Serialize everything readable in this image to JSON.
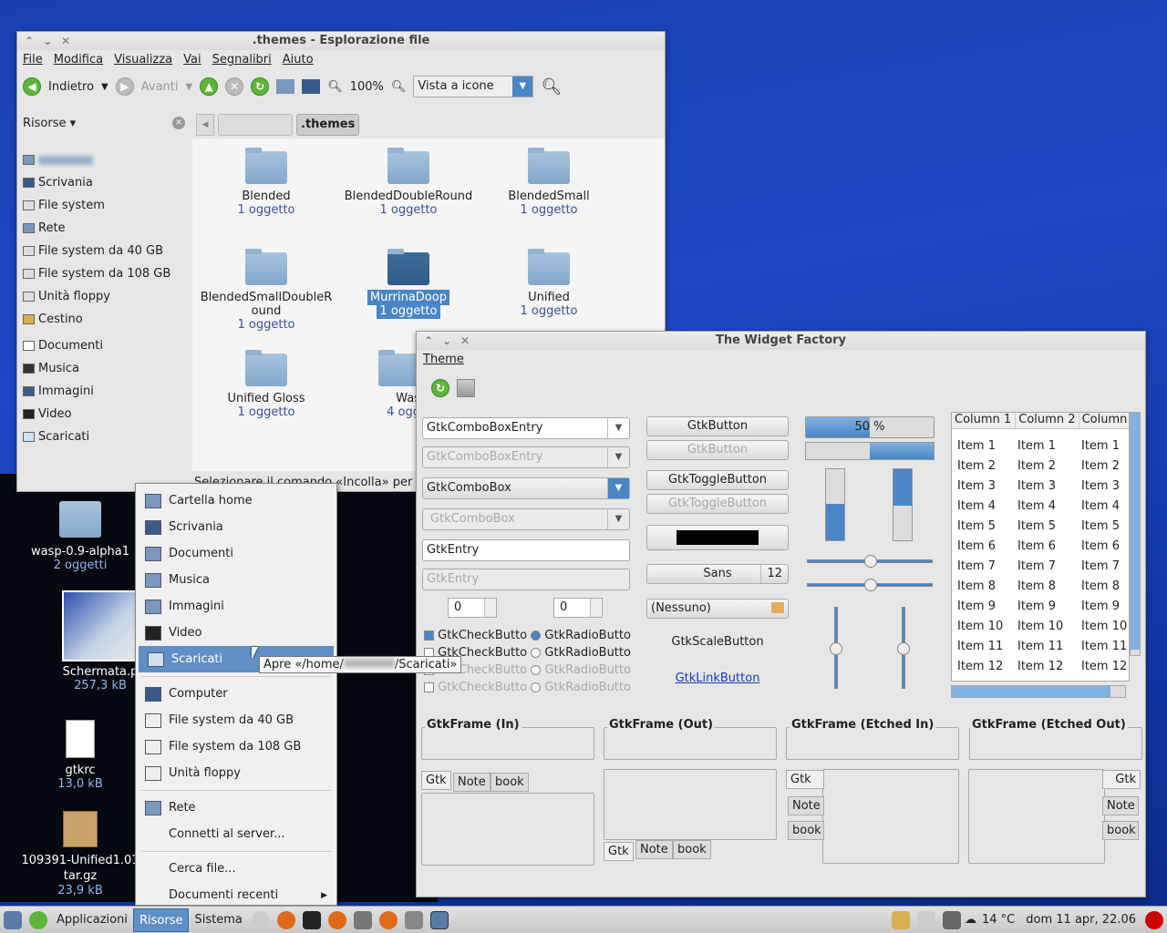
{
  "fm": {
    "title": ".themes - Esplorazione file",
    "menu": [
      "File",
      "Modifica",
      "Visualizza",
      "Vai",
      "Segnalibri",
      "Aiuto"
    ],
    "back": "Indietro",
    "forward": "Avanti",
    "zoom": "100%",
    "view_mode": "Vista a icone",
    "side_header": "Risorse ▾",
    "places": [
      "Scrivania",
      "File system",
      "Rete",
      "File system da 40 GB",
      "File system da 108 GB",
      "Unità floppy",
      "Cestino",
      "Documenti",
      "Musica",
      "Immagini",
      "Video",
      "Scaricati"
    ],
    "path": ".themes",
    "folders": [
      {
        "name": "Blended",
        "sub": "1 oggetto"
      },
      {
        "name": "BlendedDoubleRound",
        "sub": "1 oggetto"
      },
      {
        "name": "BlendedSmall",
        "sub": "1 oggetto"
      },
      {
        "name": "BlendedSmallDoubleRound",
        "sub": "1 oggetto"
      },
      {
        "name": "MurrinaDoop",
        "sub": "1 oggetto"
      },
      {
        "name": "Unified",
        "sub": "1 oggetto"
      },
      {
        "name": "Unified Gloss",
        "sub": "1 oggetto"
      },
      {
        "name": "Was",
        "sub": "4 ogg"
      }
    ],
    "status": "Selezionare il comando «Incolla» per"
  },
  "wf": {
    "title": "The Widget Factory",
    "menu": "Theme",
    "combos": [
      "GtkComboBoxEntry",
      "GtkComboBoxEntry",
      "GtkComboBox",
      "GtkComboBox"
    ],
    "entries": [
      "GtkEntry",
      "GtkEntry"
    ],
    "spin1": "0",
    "spin2": "0",
    "check": "GtkCheckButto",
    "radio": "GtkRadioButto",
    "buttons": [
      "GtkButton",
      "GtkButton",
      "GtkToggleButton",
      "GtkToggleButton"
    ],
    "font": "Sans",
    "font_size": "12",
    "file_chooser": "(Nessuno)",
    "scale_button": "GtkScaleButton",
    "link_button": "GtkLinkButton",
    "progress": "50 %",
    "columns": [
      "Column 1",
      "Column 2",
      "Column"
    ],
    "items": [
      "Item 1",
      "Item 2",
      "Item 3",
      "Item 4",
      "Item 5",
      "Item 6",
      "Item 7",
      "Item 8",
      "Item 9",
      "Item 10",
      "Item 11",
      "Item 12"
    ],
    "frames": [
      "GtkFrame (In)",
      "GtkFrame (Out)",
      "GtkFrame (Etched In)",
      "GtkFrame (Etched Out)"
    ],
    "tabs": [
      "Gtk",
      "Note",
      "book"
    ]
  },
  "menu": {
    "items1": [
      "Cartella home",
      "Scrivania",
      "Documenti",
      "Musica",
      "Immagini",
      "Video",
      "Scaricati"
    ],
    "items2": [
      "Computer",
      "File system da 40 GB",
      "File system da 108 GB",
      "Unità floppy"
    ],
    "rete": "Rete",
    "connect": "Connetti al server...",
    "search": "Cerca file...",
    "recent": "Documenti recenti",
    "tooltip": "Apre «/home/",
    "tooltip_end": "/Scaricati»"
  },
  "desktop": [
    {
      "name": "wasp-0.9-alpha1",
      "sub": "2 oggetti"
    },
    {
      "name": "Schermata.p",
      "sub": "257,3 kB"
    },
    {
      "name": "gtkrc",
      "sub": "13,0 kB"
    },
    {
      "name": "109391-Unified1.01 tar.gz",
      "sub": "23,9 kB"
    }
  ],
  "taskbar": {
    "apps": "Applicazioni",
    "places": "Risorse",
    "system": "Sistema",
    "temp": "14 °C",
    "clock": "dom 11 apr, 22.06"
  }
}
